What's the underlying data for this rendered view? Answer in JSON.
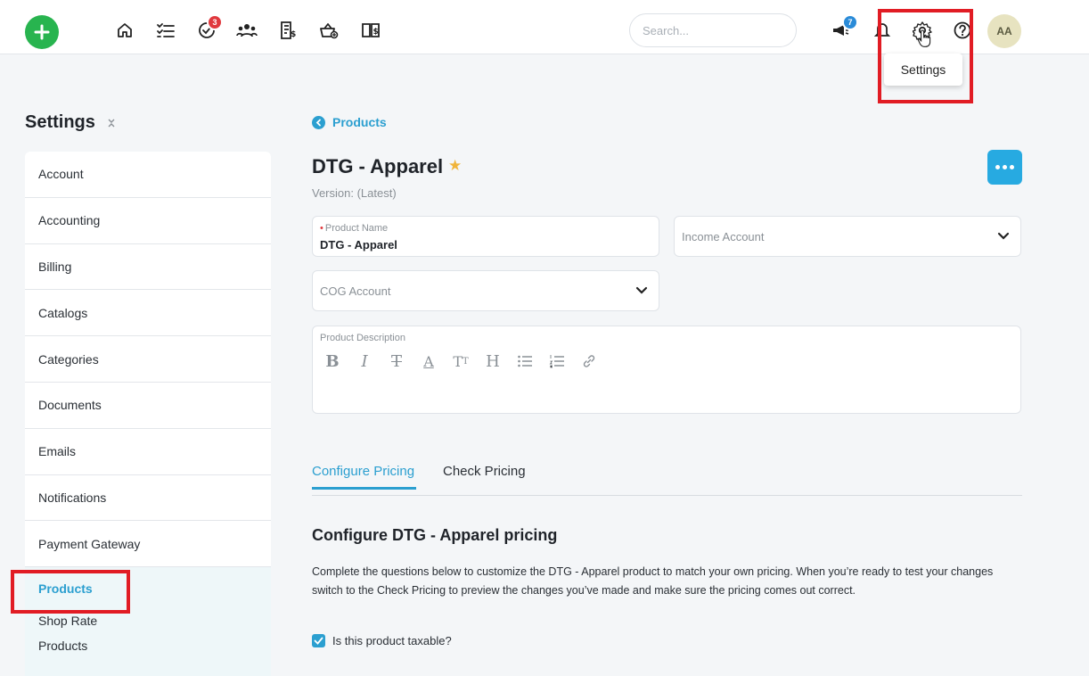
{
  "topbar": {
    "search_placeholder": "Search...",
    "tasks_badge": "3",
    "announcements_badge": "7",
    "avatar_initials": "AA",
    "tooltip": "Settings",
    "accent_add": "#28b44f"
  },
  "sidebar": {
    "title": "Settings",
    "items": [
      {
        "label": "Account"
      },
      {
        "label": "Accounting"
      },
      {
        "label": "Billing"
      },
      {
        "label": "Catalogs"
      },
      {
        "label": "Categories"
      },
      {
        "label": "Documents"
      },
      {
        "label": "Emails"
      },
      {
        "label": "Notifications"
      },
      {
        "label": "Payment Gateway"
      }
    ],
    "active": {
      "label": "Products",
      "sub1": "Shop Rate",
      "sub2": "Products"
    }
  },
  "main": {
    "breadcrumb": "Products",
    "title": "DTG - Apparel",
    "version": "Version: (Latest)",
    "product_name_label": "Product Name",
    "product_name_value": "DTG - Apparel",
    "income_account_placeholder": "Income Account",
    "cog_account_placeholder": "COG Account",
    "description_label": "Product Description",
    "tabs": [
      {
        "label": "Configure Pricing",
        "active": true
      },
      {
        "label": "Check Pricing",
        "active": false
      }
    ],
    "section_title": "Configure DTG - Apparel pricing",
    "section_desc": "Complete the questions below to customize the DTG - Apparel product to match your own pricing. When you’re ready to test your changes switch to the Check Pricing to preview the changes you’ve made and make sure the pricing comes out correct.",
    "taxable_label": "Is this product taxable?",
    "taxable_checked": true
  },
  "colors": {
    "accent": "#2b9fd0",
    "highlight_box": "#e11c24",
    "star": "#f0b43a"
  }
}
